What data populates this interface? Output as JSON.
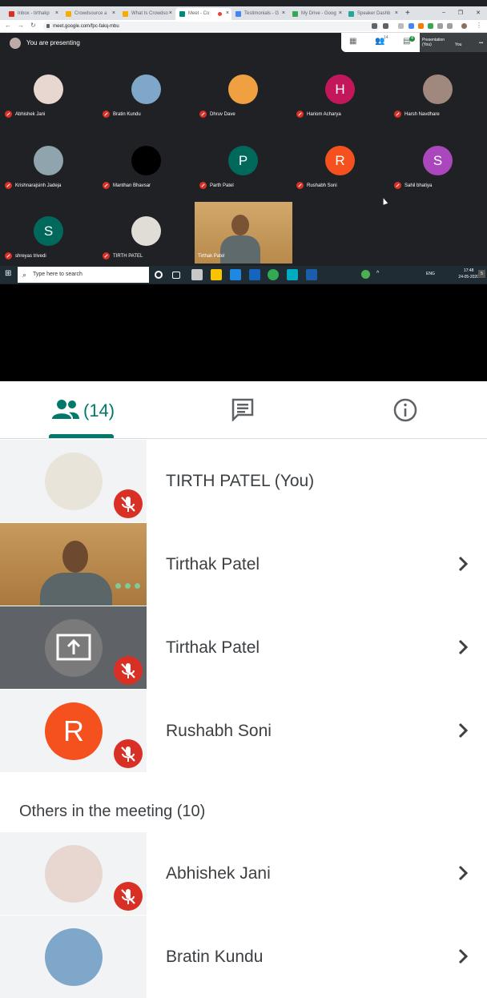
{
  "browser": {
    "tabs": [
      {
        "label": "Inbox - tirthakp",
        "color": "#d93025",
        "active": false
      },
      {
        "label": "Crowdsource a",
        "color": "#f9ab00",
        "active": false
      },
      {
        "label": "What Is Crowdso",
        "color": "#f9ab00",
        "active": false
      },
      {
        "label": "Meet - Co",
        "color": "#00897b",
        "active": true
      },
      {
        "label": "Testimonials - G",
        "color": "#4285f4",
        "active": false
      },
      {
        "label": "My Drive - Goog",
        "color": "#34a853",
        "active": false
      },
      {
        "label": "Speaker Dashb",
        "color": "#26a69a",
        "active": false
      }
    ],
    "url": "meet.google.com/fpc-fakq-mbu"
  },
  "meet": {
    "presenting_text": "You are presenting",
    "participant_count": "14",
    "chat_badge": "4",
    "presentation_label": "Presentation (You)",
    "you_label": "You",
    "tiles": [
      {
        "name": "Abhishek Jani",
        "initial": "",
        "color": "#e8d6d0"
      },
      {
        "name": "Bratin Kundu",
        "initial": "",
        "color": "#7fa7c9"
      },
      {
        "name": "Dhruv Dave",
        "initial": "",
        "color": "#f0a040"
      },
      {
        "name": "Hariom Acharya",
        "initial": "H",
        "color": "#c2185b"
      },
      {
        "name": "Harsh Navdhare",
        "initial": "",
        "color": "#a1887f"
      },
      {
        "name": "Krishnarajsinh Jadeja",
        "initial": "",
        "color": "#90a4ae"
      },
      {
        "name": "Manthan Bhavsar",
        "initial": "",
        "color": "#000000"
      },
      {
        "name": "Parth Patel",
        "initial": "P",
        "color": "#00695c"
      },
      {
        "name": "Rushabh Soni",
        "initial": "R",
        "color": "#f4511e"
      },
      {
        "name": "Sahil bhatiya",
        "initial": "S",
        "color": "#ab47bc"
      },
      {
        "name": "shreyas trivedi",
        "initial": "S",
        "color": "#00695c"
      },
      {
        "name": "TIRTH PATEL",
        "initial": "",
        "color": "#e0ddd6"
      }
    ],
    "video_name": "Tirthak Patel"
  },
  "taskbar": {
    "search_placeholder": "Type here to search",
    "lang": "ENG",
    "time": "17:48",
    "date": "24-05-2020",
    "notif": "5"
  },
  "panel": {
    "tabs": {
      "people_count": "(14)"
    },
    "rows": [
      {
        "name": "TIRTH PATEL (You)",
        "avatar_color": "#e8e4da",
        "initial": "",
        "muted": true,
        "thumb": "#f1f3f4",
        "chevron": false
      },
      {
        "name": "Tirthak Patel",
        "avatar_color": "",
        "initial": "",
        "muted": false,
        "thumb": "video",
        "chevron": true
      },
      {
        "name": "Tirthak Patel",
        "avatar_color": "#7a7a7a",
        "initial": "",
        "muted": true,
        "thumb": "#5f6368",
        "chevron": true
      },
      {
        "name": "Rushabh Soni",
        "avatar_color": "#f4511e",
        "initial": "R",
        "muted": true,
        "thumb": "#f1f3f4",
        "chevron": true
      }
    ],
    "others_heading": "Others in the meeting (10)",
    "others": [
      {
        "name": "Abhishek Jani",
        "avatar_color": "#e8d6d0",
        "muted": true
      },
      {
        "name": "Bratin Kundu",
        "avatar_color": "#7fa7c9",
        "muted": false
      }
    ]
  }
}
